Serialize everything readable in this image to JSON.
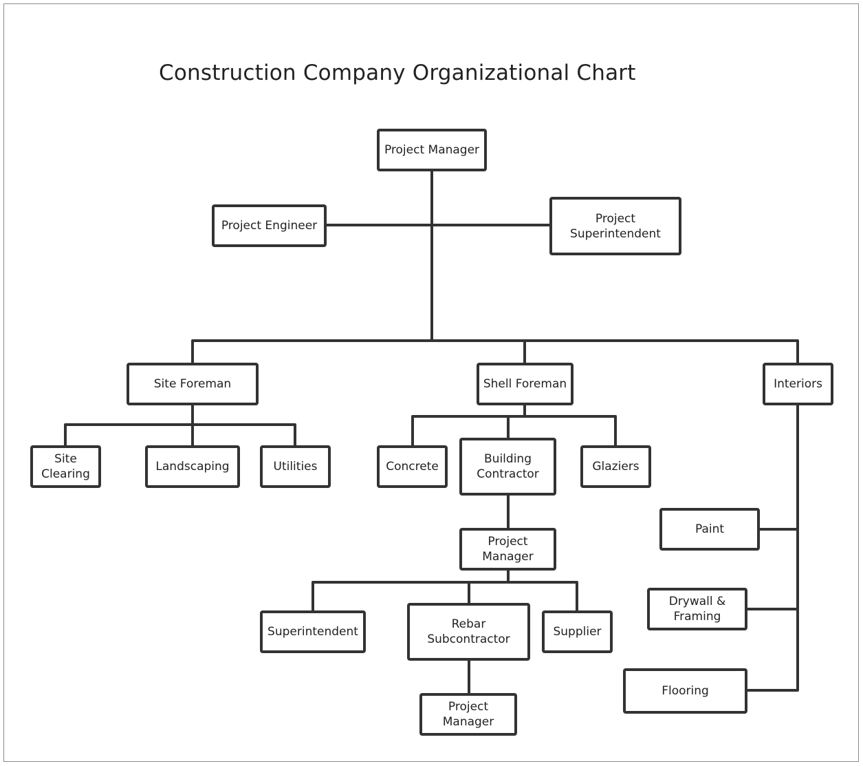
{
  "title": "Construction Company Organizational Chart",
  "colors": {
    "line": "#333333",
    "border": "#333333",
    "text": "#222222",
    "background": "#ffffff"
  },
  "nodes": [
    {
      "id": "pm",
      "label": "Project Manager"
    },
    {
      "id": "pe",
      "label": "Project Engineer"
    },
    {
      "id": "ps",
      "label": "Project\nSuperintendent"
    },
    {
      "id": "siteforeman",
      "label": "Site Foreman"
    },
    {
      "id": "shellforeman",
      "label": "Shell Foreman"
    },
    {
      "id": "interiors",
      "label": "Interiors"
    },
    {
      "id": "siteclearing",
      "label": "Site\nClearing"
    },
    {
      "id": "landscaping",
      "label": "Landscaping"
    },
    {
      "id": "utilities",
      "label": "Utilities"
    },
    {
      "id": "concrete",
      "label": "Concrete"
    },
    {
      "id": "buildingcontractor",
      "label": "Building\nContractor"
    },
    {
      "id": "glaziers",
      "label": "Glaziers"
    },
    {
      "id": "bcpm",
      "label": "Project\nManager"
    },
    {
      "id": "superintendent",
      "label": "Superintendent"
    },
    {
      "id": "rebar",
      "label": "Rebar\nSubcontractor"
    },
    {
      "id": "supplier",
      "label": "Supplier"
    },
    {
      "id": "rebarpm",
      "label": "Project\nManager"
    },
    {
      "id": "paint",
      "label": "Paint"
    },
    {
      "id": "drywall",
      "label": "Drywall &\nFraming"
    },
    {
      "id": "flooring",
      "label": "Flooring"
    }
  ],
  "edges": [
    [
      "pm",
      "pe"
    ],
    [
      "pm",
      "ps"
    ],
    [
      "pm",
      "siteforeman"
    ],
    [
      "pm",
      "shellforeman"
    ],
    [
      "pm",
      "interiors"
    ],
    [
      "siteforeman",
      "siteclearing"
    ],
    [
      "siteforeman",
      "landscaping"
    ],
    [
      "siteforeman",
      "utilities"
    ],
    [
      "shellforeman",
      "concrete"
    ],
    [
      "shellforeman",
      "buildingcontractor"
    ],
    [
      "shellforeman",
      "glaziers"
    ],
    [
      "buildingcontractor",
      "bcpm"
    ],
    [
      "bcpm",
      "superintendent"
    ],
    [
      "bcpm",
      "rebar"
    ],
    [
      "bcpm",
      "supplier"
    ],
    [
      "rebar",
      "rebarpm"
    ],
    [
      "interiors",
      "paint"
    ],
    [
      "interiors",
      "drywall"
    ],
    [
      "interiors",
      "flooring"
    ]
  ]
}
